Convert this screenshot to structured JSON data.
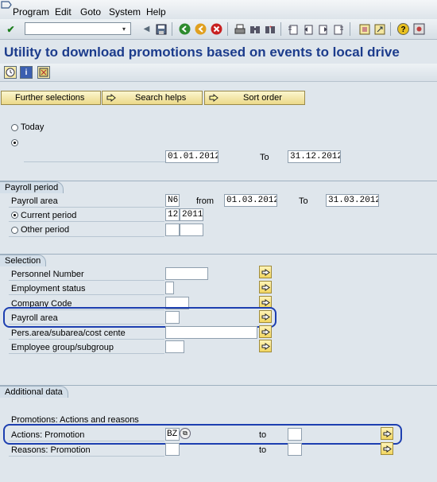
{
  "menu": {
    "items": [
      "Program",
      "Edit",
      "Goto",
      "System",
      "Help"
    ]
  },
  "toolbar": {
    "command_field": ""
  },
  "title": "Utility to download promotions based on events to local drive",
  "selection_buttons": {
    "further": "Further selections",
    "search": "Search helps",
    "sort": "Sort order"
  },
  "period": {
    "today_label": "Today",
    "date_from": "01.01.2012",
    "to_label": "To",
    "date_to": "31.12.2012"
  },
  "payroll_period": {
    "header": "Payroll period",
    "area_label": "Payroll area",
    "area_value": "N6",
    "from_label": "from",
    "from_value": "01.03.2012",
    "to_label": "To",
    "to_value": "31.03.2012",
    "current_label": "Current period",
    "current_period": "12",
    "current_year": "2011",
    "other_label": "Other period"
  },
  "selection": {
    "header": "Selection",
    "rows": [
      {
        "label": "Personnel Number",
        "value": ""
      },
      {
        "label": "Employment status",
        "value": ""
      },
      {
        "label": "Company Code",
        "value": ""
      },
      {
        "label": "Payroll area",
        "value": ""
      },
      {
        "label": "Pers.area/subarea/cost cente",
        "value": ""
      },
      {
        "label": "Employee group/subgroup",
        "value": ""
      }
    ]
  },
  "additional": {
    "header": "Additional data",
    "subheader": "Promotions: Actions and reasons",
    "actions_label": "Actions: Promotion",
    "actions_value": "BZ",
    "actions_to_label": "to",
    "reasons_label": "Reasons: Promotion",
    "reasons_to_label": "to"
  },
  "colors": {
    "title": "#1c3c8c",
    "highlight": "#1d3fb0",
    "background": "#dfe6ec"
  }
}
